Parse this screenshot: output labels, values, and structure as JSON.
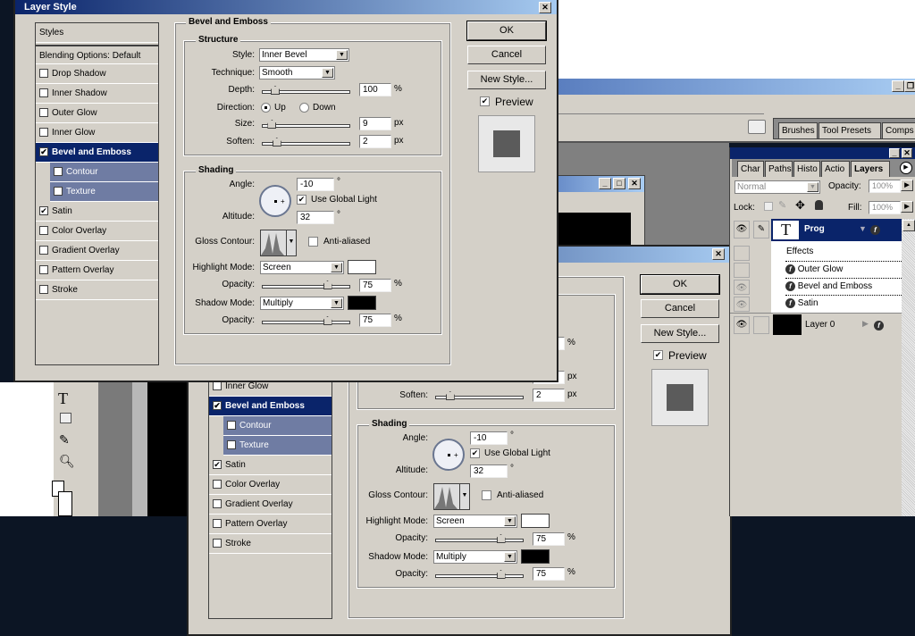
{
  "dialog": {
    "title": "Layer Style",
    "styles_list": [
      {
        "label": "Styles"
      },
      {
        "label": "Blending Options: Default"
      },
      {
        "label": "Drop Shadow",
        "checked": false
      },
      {
        "label": "Inner Shadow",
        "checked": false
      },
      {
        "label": "Outer Glow",
        "checked": false
      },
      {
        "label": "Inner Glow",
        "checked": false
      },
      {
        "label": "Bevel and Emboss",
        "checked": true,
        "selected": true
      },
      {
        "label": "Contour",
        "checked": false,
        "sub": true
      },
      {
        "label": "Texture",
        "checked": false,
        "sub": true
      },
      {
        "label": "Satin",
        "checked": true
      },
      {
        "label": "Color Overlay",
        "checked": false
      },
      {
        "label": "Gradient Overlay",
        "checked": false
      },
      {
        "label": "Pattern Overlay",
        "checked": false
      },
      {
        "label": "Stroke",
        "checked": false
      }
    ],
    "panel_title": "Bevel and Emboss",
    "structure": {
      "title": "Structure",
      "style_label": "Style:",
      "style_value": "Inner Bevel",
      "technique_label": "Technique:",
      "technique_value": "Smooth",
      "depth_label": "Depth:",
      "depth_value": "100",
      "depth_unit": "%",
      "depth_slider_fraction": 0.1,
      "direction_label": "Direction:",
      "direction_up": "Up",
      "direction_down": "Down",
      "direction_selected": "Up",
      "size_label": "Size:",
      "size_value": "9",
      "size_unit": "px",
      "size_slider_fraction": 0.06,
      "soften_label": "Soften:",
      "soften_value": "2",
      "soften_unit": "px",
      "soften_slider_fraction": 0.12
    },
    "shading": {
      "title": "Shading",
      "angle_label": "Angle:",
      "angle_value": "-10",
      "degree": "°",
      "use_global_light": "Use Global Light",
      "use_global_light_checked": true,
      "altitude_label": "Altitude:",
      "altitude_value": "32",
      "gloss_contour_label": "Gloss Contour:",
      "anti_aliased": "Anti-aliased",
      "anti_aliased_checked": false,
      "highlight_mode_label": "Highlight Mode:",
      "highlight_mode_value": "Screen",
      "highlight_color": "#ffffff",
      "highlight_opacity_label": "Opacity:",
      "highlight_opacity_value": "75",
      "percent": "%",
      "shadow_mode_label": "Shadow Mode:",
      "shadow_mode_value": "Multiply",
      "shadow_color": "#000000",
      "shadow_opacity_label": "Opacity:",
      "shadow_opacity_value": "75",
      "opacity_slider_fraction": 0.75
    },
    "buttons": {
      "ok": "OK",
      "cancel": "Cancel",
      "new_style": "New Style..."
    },
    "preview_label": "Preview",
    "preview_checked": true
  },
  "workspace": {
    "palette_well_tabs": [
      "Brushes",
      "Tool Presets",
      "Comps"
    ],
    "close_glyph": "✕",
    "min_glyph": "_",
    "max_glyph": "□",
    "restore_glyph": "❐"
  },
  "layers_palette": {
    "tabs": [
      "Char",
      "Paths",
      "Histo",
      "Actio",
      "Layers"
    ],
    "blend_mode": "Normal",
    "opacity_label": "Opacity:",
    "opacity_value": "100%",
    "lock_label": "Lock:",
    "fill_label": "Fill:",
    "fill_value": "100%",
    "layers": [
      {
        "name": "Prog",
        "thumb": "T",
        "selected": true
      },
      {
        "name": "Layer 0"
      }
    ],
    "effects_label": "Effects",
    "effects": [
      "Outer Glow",
      "Bevel and Emboss",
      "Satin"
    ],
    "fx_glyph": "f"
  },
  "colors": {
    "selection": "#0a246a",
    "dialog_face": "#d4d0c8",
    "workspace": "#808080"
  }
}
